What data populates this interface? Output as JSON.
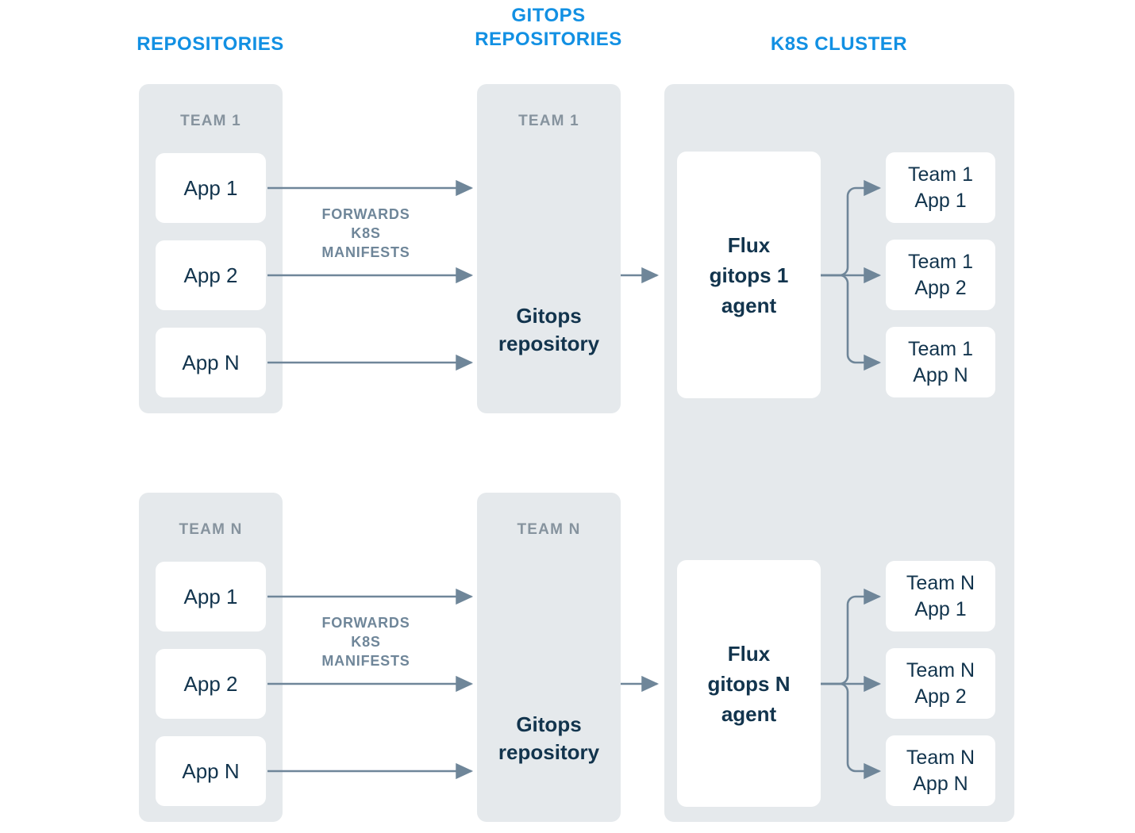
{
  "headers": {
    "repositories": "REPOSITORIES",
    "gitops_repositories": "GITOPS\nREPOSITORIES",
    "gitops_repositories_line1": "GITOPS",
    "gitops_repositories_line2": "REPOSITORIES",
    "k8s_cluster": "K8S CLUSTER"
  },
  "colors": {
    "heading_blue": "#1290e3",
    "panel_gray": "#e5e9ec",
    "panel_title_gray": "#86939e",
    "card_text_navy": "#12344d",
    "arrow_slate": "#6f8699",
    "card_white": "#ffffff",
    "page_background": "#ffffff"
  },
  "repositories": {
    "groups": [
      {
        "title": "TEAM 1",
        "apps": [
          "App 1",
          "App 2",
          "App N"
        ],
        "edge_label": "FORWARDS\nK8S\nMANIFESTS"
      },
      {
        "title": "TEAM N",
        "apps": [
          "App 1",
          "App 2",
          "App N"
        ],
        "edge_label": "FORWARDS\nK8S\nMANIFESTS"
      }
    ]
  },
  "gitops_repositories": {
    "groups": [
      {
        "title": "TEAM 1",
        "repo_label": "Gitops\nrepository"
      },
      {
        "title": "TEAM N",
        "repo_label": "Gitops\nrepository"
      }
    ]
  },
  "k8s_cluster": {
    "agents": [
      {
        "label": "Flux\ngitops 1\nagent",
        "workloads": [
          "Team 1\nApp 1",
          "Team 1\nApp 2",
          "Team 1\nApp N"
        ]
      },
      {
        "label": "Flux\ngitops N\nagent",
        "workloads": [
          "Team N\nApp 1",
          "Team N\nApp 2",
          "Team N\nApp N"
        ]
      }
    ]
  }
}
